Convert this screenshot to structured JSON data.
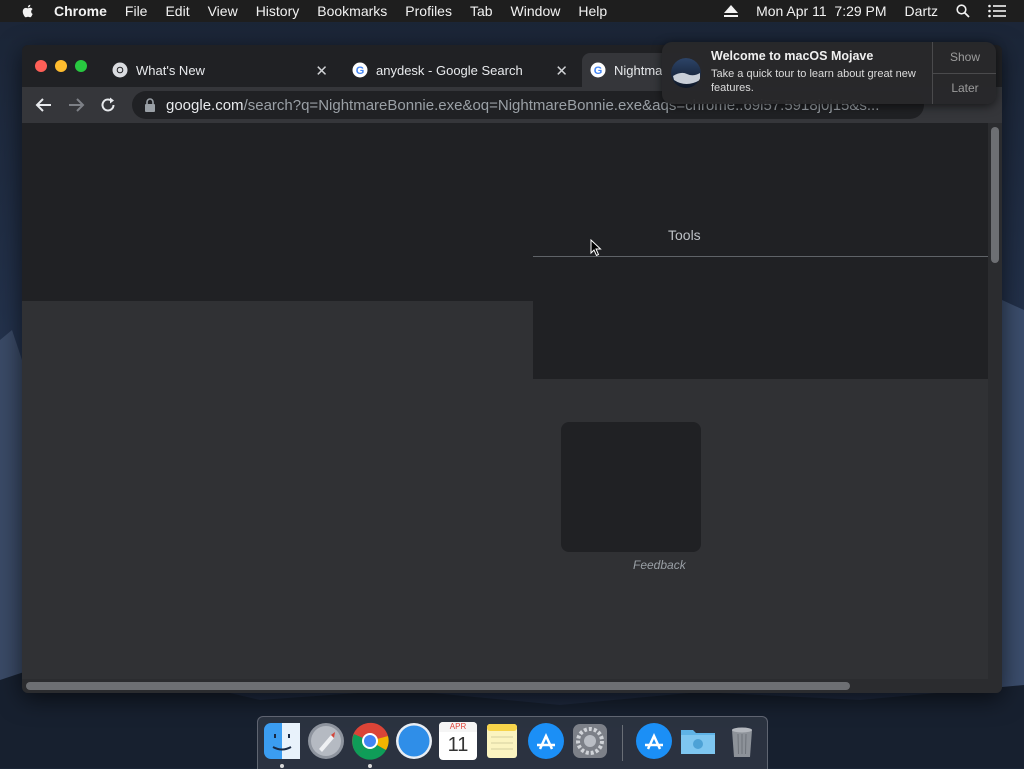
{
  "menubar": {
    "items": [
      "Chrome",
      "File",
      "Edit",
      "View",
      "History",
      "Bookmarks",
      "Profiles",
      "Tab",
      "Window",
      "Help"
    ],
    "datetime": "Mon Apr 11  7:29 PM",
    "user": "Dartz"
  },
  "browser": {
    "tabs": [
      {
        "title": "What's New"
      },
      {
        "title": "anydesk - Google Search"
      },
      {
        "title": "Nightma"
      }
    ],
    "url_host": "google.com",
    "url_path": "/search?q=NightmareBonnie.exe&oq=NightmareBonnie.exe&aqs=chrome..69i57.5918j0j15&s..."
  },
  "page": {
    "tools_label": "Tools",
    "feedback_label": "Feedback"
  },
  "notification": {
    "title": "Welcome to macOS Mojave",
    "body": "Take a quick tour to learn about great new features.",
    "show_label": "Show",
    "later_label": "Later"
  },
  "dock": {
    "calendar_month": "APR",
    "calendar_day": "11",
    "apps": [
      "finder-icon",
      "launchpad-icon",
      "chrome-icon",
      "safari-icon",
      "calendar-icon",
      "notes-icon",
      "app-store-icon",
      "system-preferences-icon",
      "app-store-icon",
      "downloads-folder-icon",
      "trash-icon"
    ]
  },
  "colors": {
    "window_bg": "#202124",
    "content_bg": "#303134",
    "toolbar_bg": "#35363a",
    "close": "#ff5f57",
    "minimize": "#febc2e",
    "zoom": "#28c840"
  }
}
